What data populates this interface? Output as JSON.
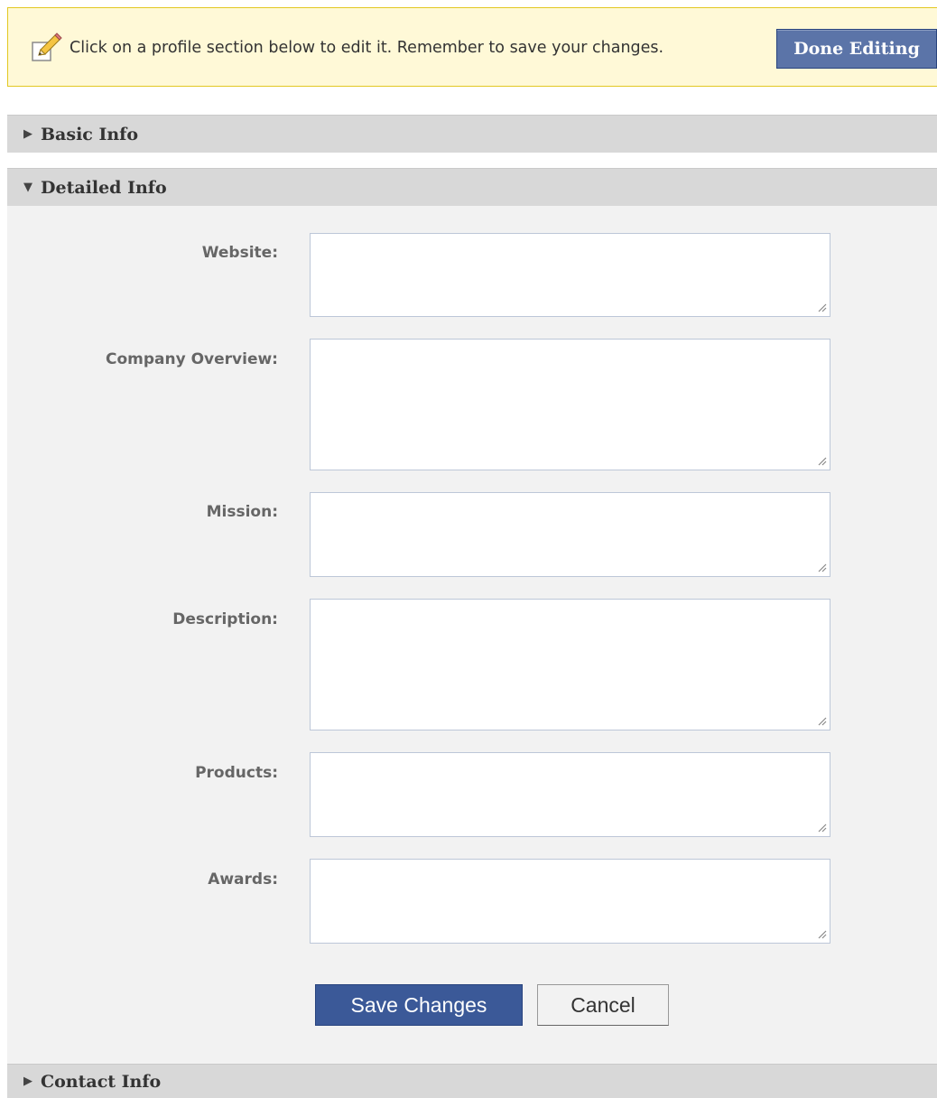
{
  "notice": {
    "icon": "pencil-edit-icon",
    "text": "Click on a profile section below to edit it. Remember to save your changes.",
    "done_label": "Done Editing"
  },
  "sections": {
    "basic": {
      "arrow": "▶",
      "label": "Basic Info",
      "expanded": false
    },
    "detailed": {
      "arrow": "▼",
      "label": "Detailed Info",
      "expanded": true
    },
    "contact": {
      "arrow": "▶",
      "label": "Contact Info",
      "expanded": false
    }
  },
  "fields": {
    "website": {
      "label": "Website:",
      "value": ""
    },
    "company_overview": {
      "label": "Company Overview:",
      "value": ""
    },
    "mission": {
      "label": "Mission:",
      "value": ""
    },
    "description": {
      "label": "Description:",
      "value": ""
    },
    "products": {
      "label": "Products:",
      "value": ""
    },
    "awards": {
      "label": "Awards:",
      "value": ""
    }
  },
  "actions": {
    "save_label": "Save Changes",
    "cancel_label": "Cancel"
  },
  "colors": {
    "notice_bg": "#fff9d7",
    "notice_border": "#e2c822",
    "primary_button": "#3b5998",
    "section_header": "#d8d8d8",
    "section_body": "#f2f2f2"
  }
}
